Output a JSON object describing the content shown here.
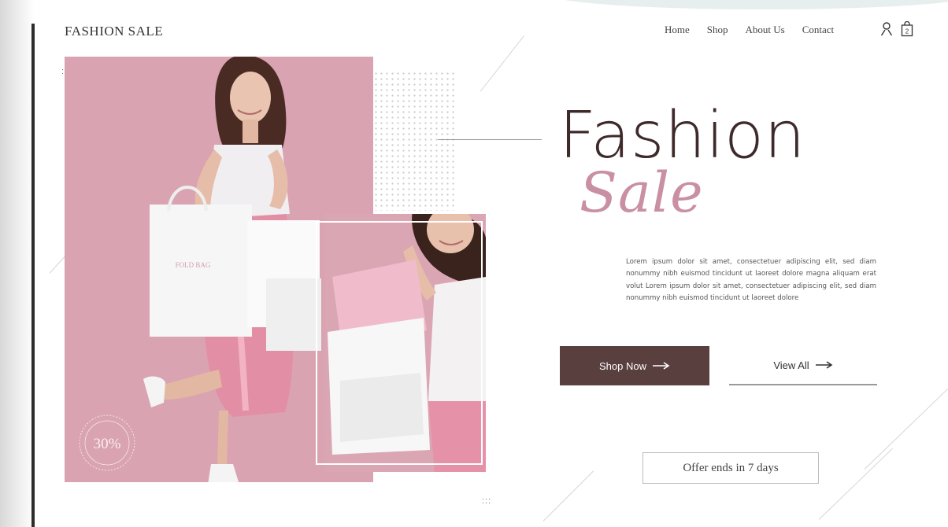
{
  "brand": "FASHION SALE",
  "nav": {
    "items": [
      "Home",
      "Shop",
      "About Us",
      "Contact"
    ],
    "user_icon": "user-icon",
    "bag_icon": "shopping-bag-icon",
    "cart_count": "2"
  },
  "hero": {
    "title_main": "Fashion",
    "title_script": "Sale",
    "description": "Lorem ipsum dolor sit amet, consectetuer adipiscing elit, sed diam nonummy nibh euismod tincidunt ut laoreet dolore magna aliquam erat volut Lorem ipsum dolor sit amet, consectetuer adipiscing elit, sed diam nonummy nibh euismod tincidunt ut laoreet dolore",
    "primary_button": "Shop Now",
    "secondary_button": "View All",
    "arrow_icon": "arrow-right-icon",
    "offer": "Offer ends in 7 days"
  },
  "images": {
    "badge_text": "30%",
    "bag_print": "FOLD BAG"
  },
  "colors": {
    "accent_pink": "#d9a3b1",
    "dark_brown": "#5a3f3f",
    "script_pink": "#c98fa2"
  }
}
